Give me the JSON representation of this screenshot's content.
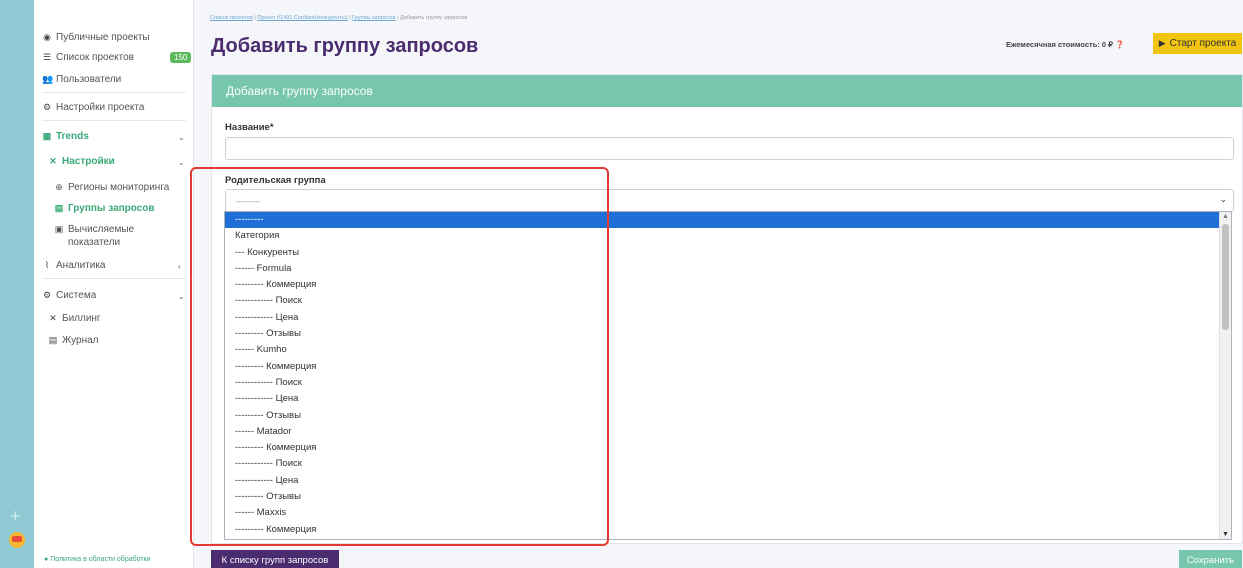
{
  "sidebar": {
    "public_projects": "Публичные проекты",
    "project_list": "Список проектов",
    "project_count": "150",
    "users": "Пользователи",
    "project_settings": "Настройки проекта",
    "trends": "Trends",
    "settings": "Настройки",
    "regions": "Регионы мониторинга",
    "query_groups": "Группы запросов",
    "computed_line1": "Вычисляемые",
    "computed_line2": "показатели",
    "analytics": "Аналитика",
    "system": "Система",
    "billing": "Биллинг",
    "journal": "Журнал",
    "policy": "Политика в области обработки"
  },
  "breadcrumbs": {
    "item1": "Список проектов",
    "item2": "Проект #1491 Cordiant(конкуренты)",
    "item3": "Группы запросов",
    "item4": "Добавить группу запросов",
    "sep": "|"
  },
  "header": {
    "title": "Добавить группу запросов",
    "cost_label": "Ежемесячная стоимость: 0 ₽",
    "start_button": "Старт проекта"
  },
  "form": {
    "card_title": "Добавить группу запросов",
    "name_label": "Название*",
    "name_value": "",
    "parent_label": "Родительская группа",
    "parent_value": "---------"
  },
  "dropdown": {
    "options": [
      "---------",
      "Категория",
      "--- Конкуренты",
      "------ Formula",
      "--------- Коммерция",
      "------------ Поиск",
      "------------ Цена",
      "--------- Отзывы",
      "------ Kumho",
      "--------- Коммерция",
      "------------ Поиск",
      "------------ Цена",
      "--------- Отзывы",
      "------ Matador",
      "--------- Коммерция",
      "------------ Поиск",
      "------------ Цена",
      "--------- Отзывы",
      "------ Maxxis",
      "--------- Коммерция"
    ],
    "selected_index": 0
  },
  "footer": {
    "back_button": "К списку групп запросов",
    "save_button": "Сохранить"
  },
  "colors": {
    "accent_green": "#76c7ad",
    "brand_purple": "#4a2c6f",
    "start_yellow": "#f1c40f",
    "highlight_red": "#e53935",
    "selected_blue": "#1f6fd6"
  }
}
